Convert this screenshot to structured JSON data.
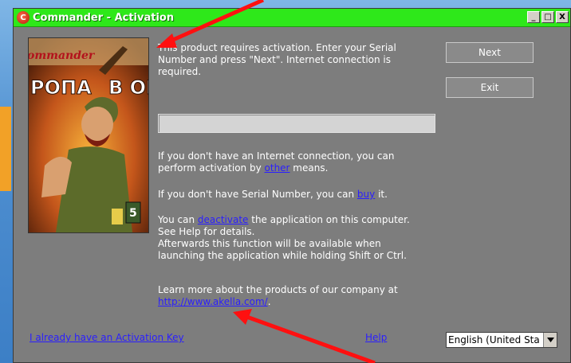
{
  "window": {
    "title": "Commander - Activation",
    "app_icon_glyph": "C",
    "controls": [
      "_",
      "□",
      "X"
    ]
  },
  "cover": {
    "text_top": "ommander",
    "text_left": "РОПА",
    "text_right": "В ОГ",
    "badge_1": "",
    "badge_2": "5"
  },
  "content": {
    "intro": "This product requires activation. Enter your Serial Number and press \"Next\". Internet connection is required.",
    "serial_value": "",
    "no_internet_prefix": "If you don't have an Internet connection, you can perform activation by ",
    "no_internet_link": "other",
    "no_internet_suffix": " means.",
    "no_serial_prefix": "If you don't have Serial Number, you can ",
    "no_serial_link": "buy",
    "no_serial_suffix": " it.",
    "deactivate_prefix": "You can ",
    "deactivate_link": "deactivate",
    "deactivate_suffix": " the application on this computer.",
    "deactivate_line2": "See Help for details.",
    "deactivate_line3": "Afterwards this function will be available when",
    "deactivate_line4": "launching the application while holding Shift or Ctrl.",
    "learn_more": "Learn more about the products of our company at",
    "company_url": "http://www.akella.com/",
    "url_suffix": "."
  },
  "buttons": {
    "next": "Next",
    "exit": "Exit"
  },
  "footer": {
    "activation_key_link": "I already have an Activation Key",
    "help_link": "Help",
    "language_value": "English (United Sta"
  },
  "colors": {
    "titlebar": "#2ee81a",
    "window_bg": "#7d7d7d",
    "link": "#2a1eff",
    "annotation_arrow": "#ff1010"
  }
}
